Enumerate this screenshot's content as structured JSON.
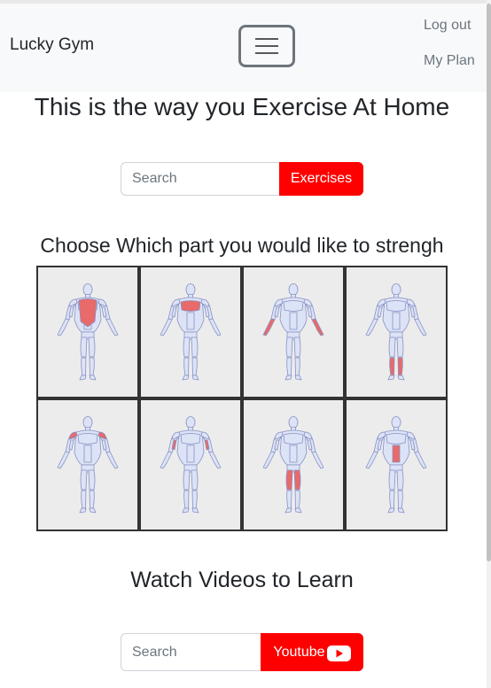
{
  "navbar": {
    "brand": "Lucky Gym",
    "links": [
      "Log out",
      "My Plan"
    ]
  },
  "main": {
    "title": "This is the way you Exercise At Home",
    "exercise_search": {
      "placeholder": "Search",
      "button": "Exercises"
    },
    "choose_heading": "Choose Which part you would like to strengh",
    "muscle_groups": [
      "back",
      "chest",
      "forearms",
      "calves",
      "shoulders",
      "triceps",
      "quads",
      "abs"
    ],
    "videos_heading": "Watch Videos to Learn",
    "video_search": {
      "placeholder": "Search",
      "button": "Youtube"
    }
  },
  "colors": {
    "brand_red": "#ff0000",
    "highlight": "#e86a6a",
    "body_fill": "#dde3f6",
    "body_stroke": "#8791c4"
  }
}
